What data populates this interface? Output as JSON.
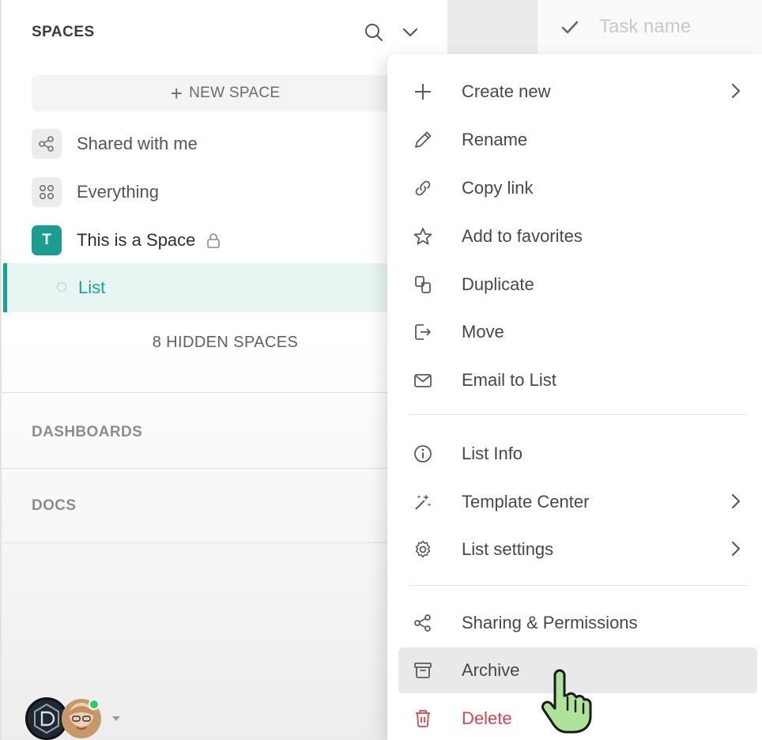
{
  "sidebar": {
    "spaces_header": "SPACES",
    "new_space_label": "NEW SPACE",
    "items": [
      {
        "label": "Shared with me",
        "icon": "share-icon"
      },
      {
        "label": "Everything",
        "icon": "grid-icon"
      }
    ],
    "space": {
      "badge": "T",
      "name": "This is a Space",
      "color": "#1a9e8f"
    },
    "list_item": "List",
    "hidden_spaces": "8 HIDDEN SPACES",
    "dashboards": "DASHBOARDS",
    "docs": "DOCS"
  },
  "main": {
    "task_placeholder": "Task name"
  },
  "menu": {
    "items": [
      {
        "label": "Create new",
        "icon": "plus-icon",
        "submenu": true
      },
      {
        "label": "Rename",
        "icon": "pencil-icon"
      },
      {
        "label": "Copy link",
        "icon": "link-icon"
      },
      {
        "label": "Add to favorites",
        "icon": "star-icon"
      },
      {
        "label": "Duplicate",
        "icon": "duplicate-icon"
      },
      {
        "label": "Move",
        "icon": "move-icon"
      },
      {
        "label": "Email to List",
        "icon": "email-icon"
      },
      {
        "label": "List Info",
        "icon": "info-icon"
      },
      {
        "label": "Template Center",
        "icon": "wand-icon",
        "submenu": true
      },
      {
        "label": "List settings",
        "icon": "gear-icon",
        "submenu": true
      },
      {
        "label": "Sharing & Permissions",
        "icon": "share-icon"
      },
      {
        "label": "Archive",
        "icon": "archive-icon",
        "hovered": true
      },
      {
        "label": "Delete",
        "icon": "trash-icon",
        "danger": true
      }
    ]
  },
  "colors": {
    "accent": "#13a592",
    "danger": "#d4454c",
    "hover": "#e9e9eb"
  }
}
